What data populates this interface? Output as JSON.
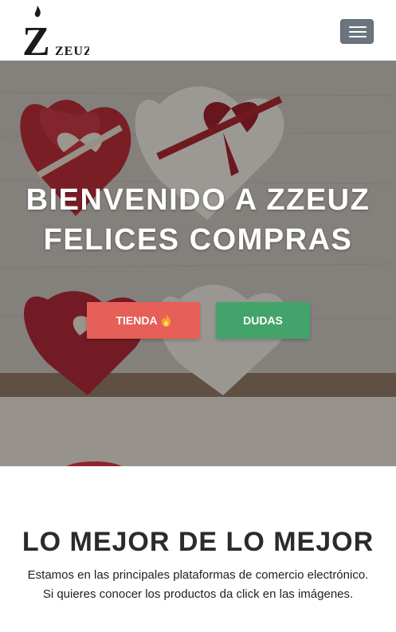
{
  "navbar": {
    "logo_text": "ZEUZ",
    "logo_letter": "Z",
    "menu_toggle_icon": "hamburger-icon"
  },
  "hero": {
    "title_line1": "BIENVENIDO A ZZEUZ",
    "title_line2": "FELICES COMPRAS",
    "button_tienda": "TIENDA",
    "button_tienda_icon": "flame-icon",
    "button_dudas": "DUDAS",
    "background_image": "heart-shaped gift boxes with ribbons"
  },
  "section": {
    "title": "LO MEJOR DE LO MEJOR",
    "text_line1": "Estamos en las principales plataformas de comercio electrónico.",
    "text_line2": "Si quieres conocer los productos da click en las imágenes."
  },
  "colors": {
    "tienda_button": "#e65f58",
    "dudas_button": "#43a46b",
    "toggler": "#6c757d",
    "heading_text": "#2b2b2b"
  }
}
